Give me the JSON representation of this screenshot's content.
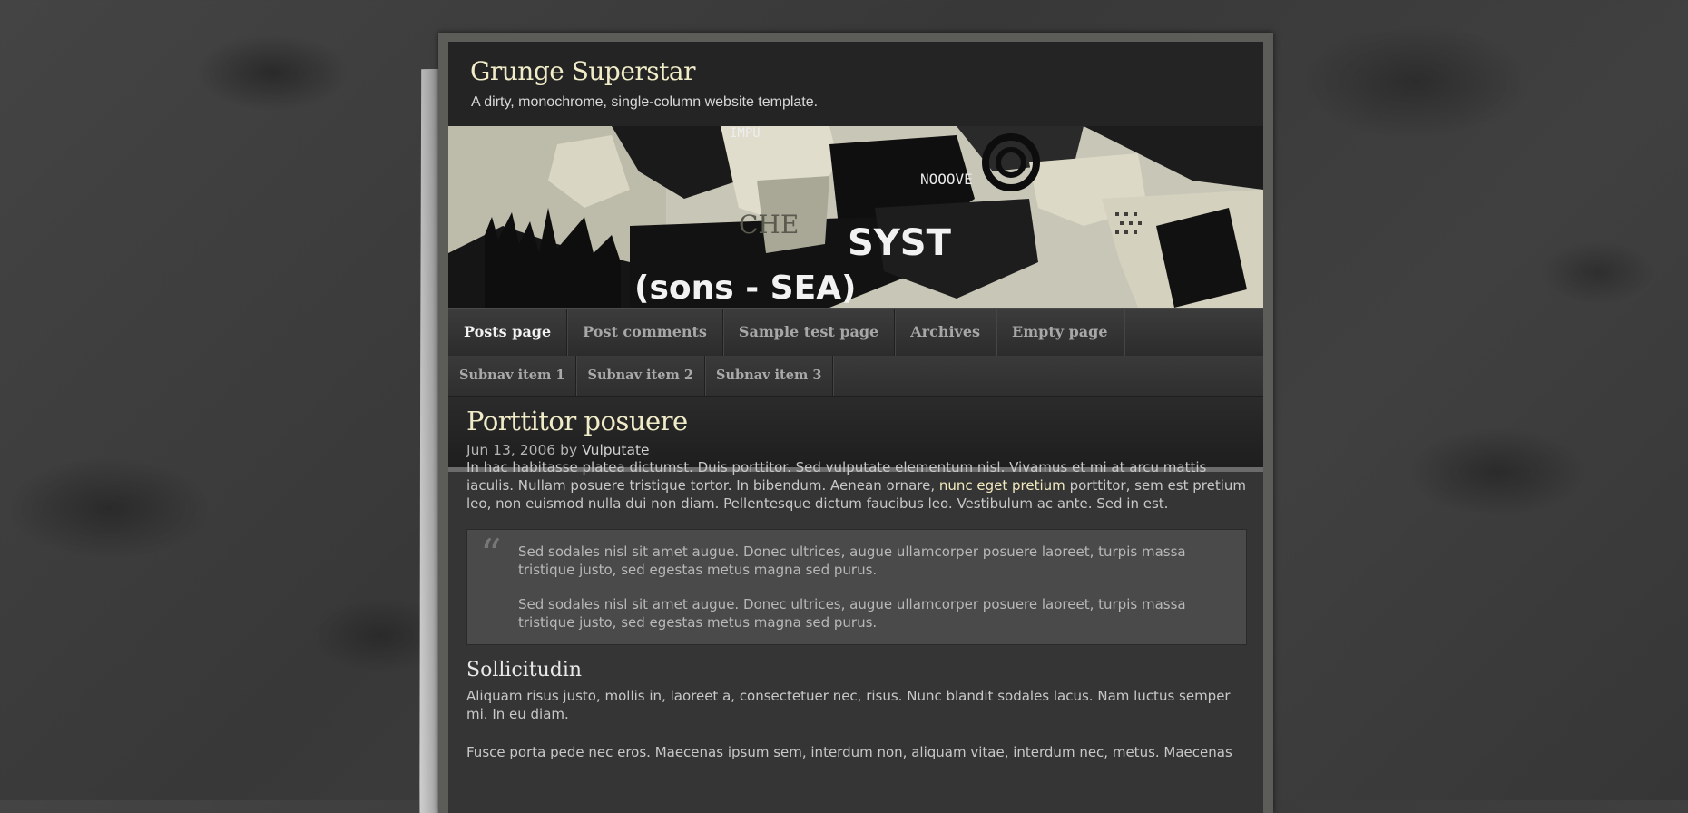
{
  "site": {
    "title": "Grunge Superstar",
    "tagline": "A dirty, monochrome, single-column website template."
  },
  "nav": {
    "items": [
      {
        "label": "Posts page",
        "active": true
      },
      {
        "label": "Post comments",
        "active": false
      },
      {
        "label": "Sample test page",
        "active": false
      },
      {
        "label": "Archives",
        "active": false
      },
      {
        "label": "Empty page",
        "active": false
      }
    ]
  },
  "subnav": {
    "items": [
      {
        "label": "Subnav item 1"
      },
      {
        "label": "Subnav item 2"
      },
      {
        "label": "Subnav item 3"
      }
    ]
  },
  "banner": {
    "texts": [
      "IMPU",
      "NOOOVE",
      "SYST",
      "(sons - SEA)",
      "CHE"
    ]
  },
  "post": {
    "title": "Porttitor posuere",
    "date": "Jun 13, 2006",
    "by": "by",
    "author": "Vulputate",
    "intro_before_link": "In hac habitasse platea dictumst. Duis porttitor. Sed vulputate elementum nisl. Vivamus et mi at arcu mattis iaculis. Nullam posuere tristique tortor. In bibendum. Aenean ornare, ",
    "intro_link": "nunc eget pretium",
    "intro_after_link": " porttitor, sem est pretium leo, non euismod nulla dui non diam. Pellentesque dictum faucibus leo. Vestibulum ac ante. Sed in est.",
    "quote_mark": "“",
    "quote_paragraphs": [
      "Sed sodales nisl sit amet augue. Donec ultrices, augue ullamcorper posuere laoreet, turpis massa tristique justo, sed egestas metus magna sed purus.",
      "Sed sodales nisl sit amet augue. Donec ultrices, augue ullamcorper posuere laoreet, turpis massa tristique justo, sed egestas metus magna sed purus."
    ],
    "subheading": "Sollicitudin",
    "para2": "Aliquam risus justo, mollis in, laoreet a, consectetuer nec, risus. Nunc blandit sodales lacus. Nam luctus semper mi. In eu diam.",
    "para3": "Fusce porta pede nec eros. Maecenas ipsum sem, interdum non, aliquam vitae, interdum nec, metus. Maecenas"
  }
}
